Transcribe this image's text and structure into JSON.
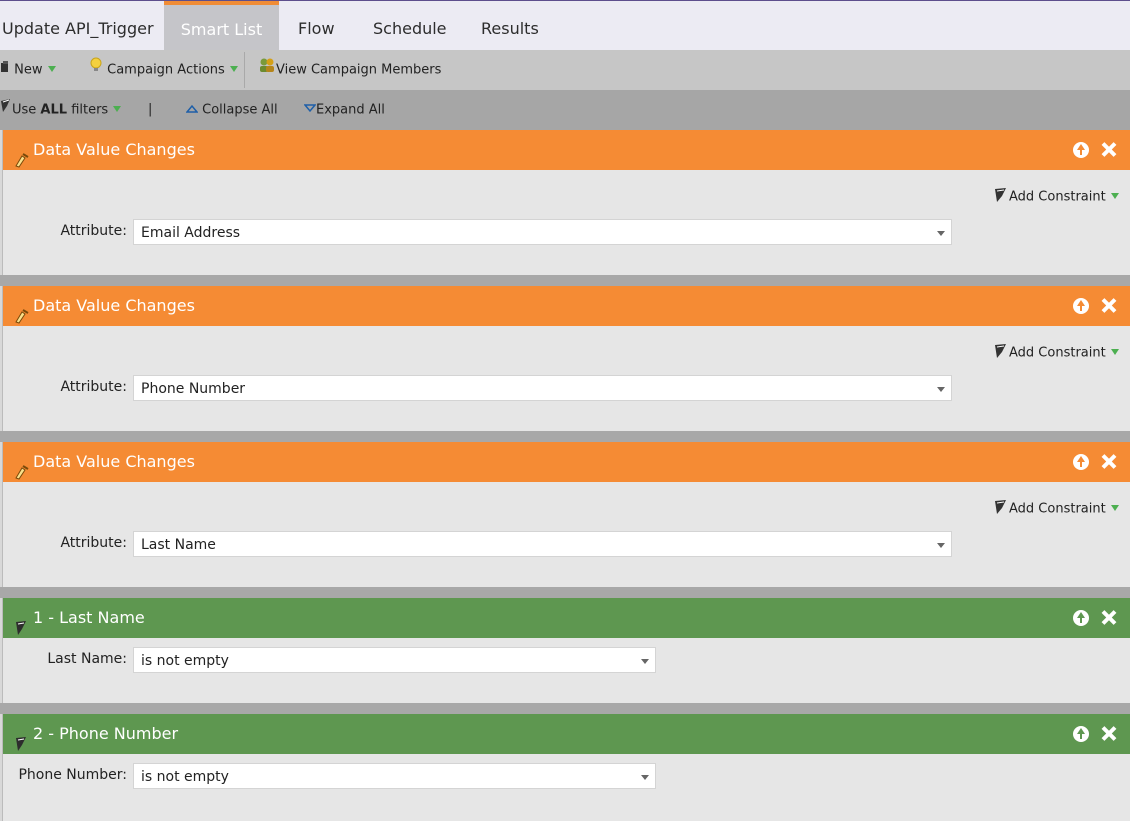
{
  "tabs": [
    {
      "label": "Update API_Trigger"
    },
    {
      "label": "Smart List"
    },
    {
      "label": "Flow"
    },
    {
      "label": "Schedule"
    },
    {
      "label": "Results"
    }
  ],
  "active_tab": "Smart List",
  "toolbar": {
    "new_label": "New",
    "campaign_actions_label": "Campaign Actions",
    "view_members_label": "View Campaign Members"
  },
  "filterbar": {
    "use_prefix": "Use ",
    "use_bold": "ALL",
    "use_suffix": " filters",
    "separator": "|",
    "collapse_label": "Collapse All",
    "expand_label": "Expand All"
  },
  "blocks": [
    {
      "title": "Data Value Changes",
      "color": "#f58b34",
      "constraint": "Add Constraint",
      "field_label": "Attribute:",
      "value": "Email Address"
    },
    {
      "title": "Data Value Changes",
      "color": "#f58b34",
      "constraint": "Add Constraint",
      "field_label": "Attribute:",
      "value": "Phone Number"
    },
    {
      "title": "Data Value Changes",
      "color": "#f58b34",
      "constraint": "Add Constraint",
      "field_label": "Attribute:",
      "value": "Last Name"
    },
    {
      "title": "1 - Last Name",
      "color": "#5e9750",
      "field_label": "Last Name:",
      "value": "is not empty"
    },
    {
      "title": "2 - Phone Number",
      "color": "#5e9750",
      "field_label": "Phone Number:",
      "value": "is not empty"
    }
  ]
}
